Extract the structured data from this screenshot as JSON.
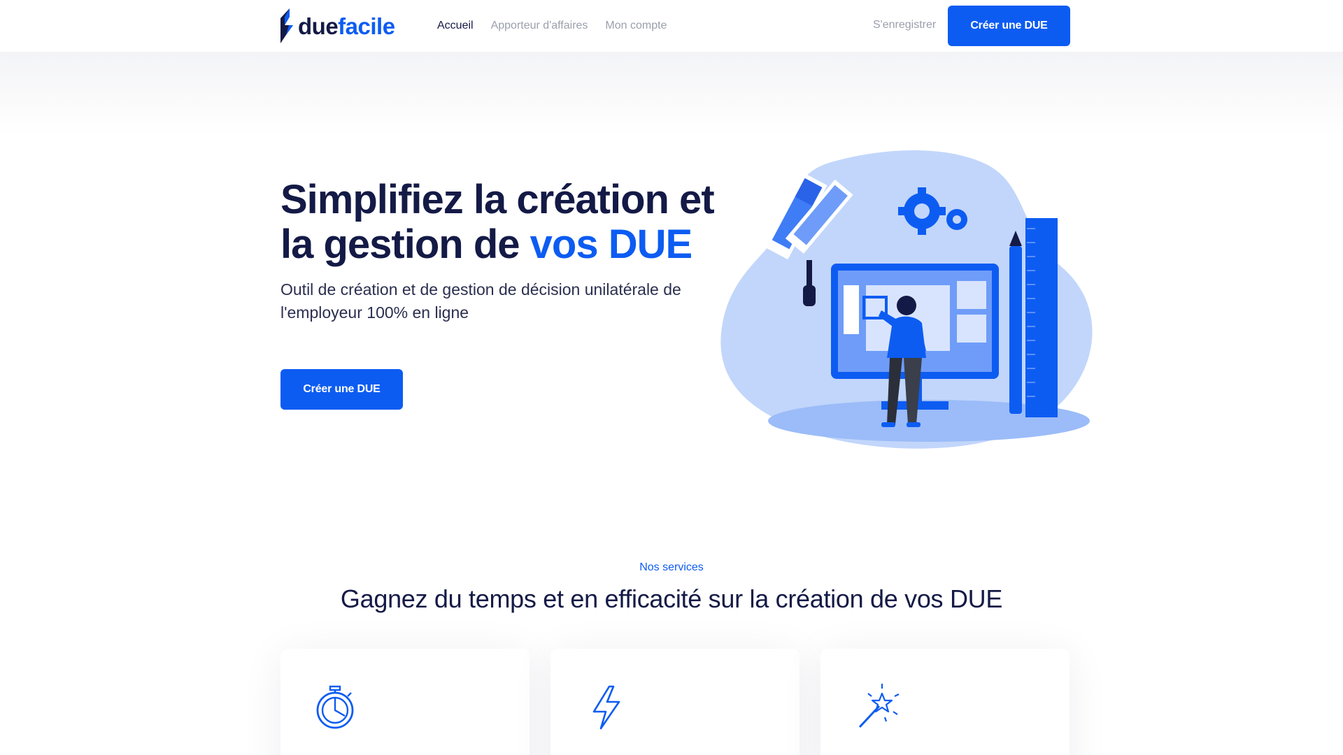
{
  "brand": {
    "name_part1": "due",
    "name_part2": "facile",
    "primary_color": "#0d5cf2",
    "text_color": "#141a46",
    "muted_color": "#9aa0ab",
    "logo_icon": "lightning-logo-icon"
  },
  "nav": {
    "items": [
      {
        "label": "Accueil",
        "active": true
      },
      {
        "label": "Apporteur d'affaires",
        "active": false
      },
      {
        "label": "Mon compte",
        "active": false
      }
    ],
    "register_label": "S'enregistrer",
    "cta_label": "Créer une DUE"
  },
  "hero": {
    "title_part1": "Simplifiez la création et la gestion de ",
    "title_accent": "vos DUE",
    "subtitle": "Outil de création et de gestion de décision unilatérale de l'employeur 100% en ligne",
    "cta_label": "Créer une DUE",
    "illustration_icon": "person-designing-on-monitor-illustration"
  },
  "services": {
    "eyebrow": "Nos services",
    "title": "Gagnez du temps et en efficacité sur la création de vos DUE",
    "cards": [
      {
        "icon": "stopwatch-icon"
      },
      {
        "icon": "lightning-icon"
      },
      {
        "icon": "magic-wand-icon"
      }
    ]
  }
}
